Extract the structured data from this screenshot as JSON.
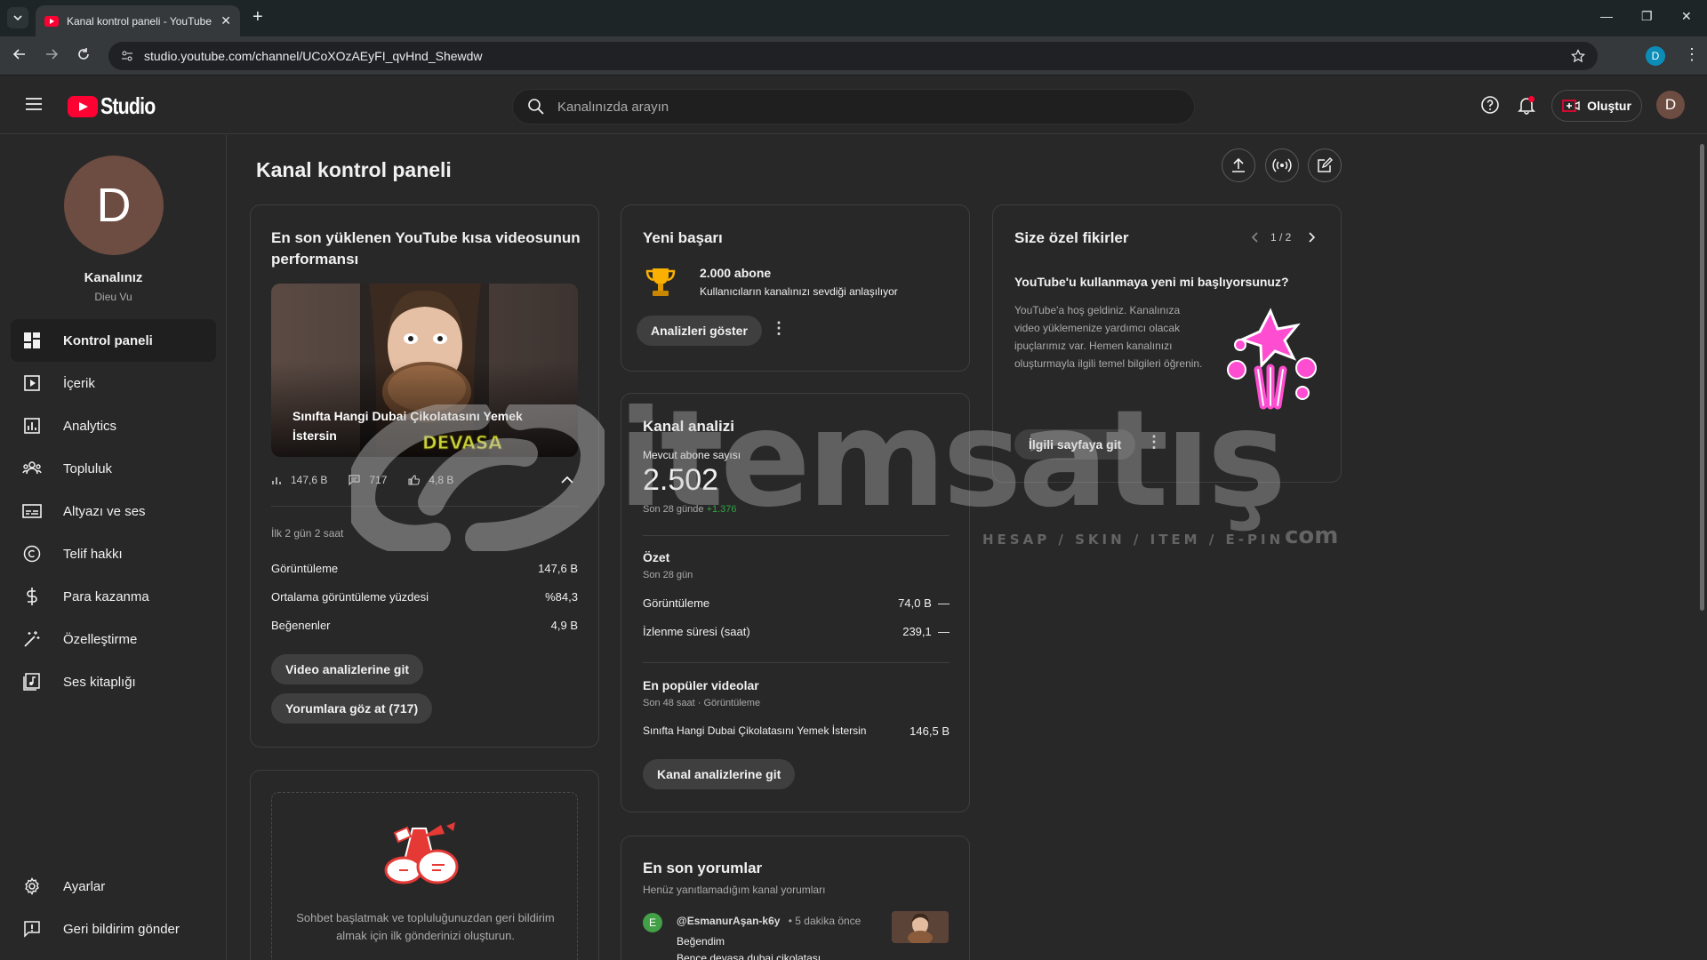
{
  "browser": {
    "tab_title": "Kanal kontrol paneli - YouTube",
    "url": "studio.youtube.com/channel/UCoXOzAEyFI_qvHnd_Shewdw",
    "profile_initial": "D"
  },
  "header": {
    "logo_text": "Studio",
    "search_placeholder": "Kanalınızda arayın",
    "create_label": "Oluştur",
    "avatar_initial": "D"
  },
  "sidebar": {
    "avatar_initial": "D",
    "channel_label": "Kanalınız",
    "channel_name": "Dieu Vu",
    "items": [
      {
        "label": "Kontrol paneli",
        "icon": "dashboard-icon"
      },
      {
        "label": "İçerik",
        "icon": "content-icon"
      },
      {
        "label": "Analytics",
        "icon": "analytics-icon"
      },
      {
        "label": "Topluluk",
        "icon": "community-icon"
      },
      {
        "label": "Altyazı ve ses",
        "icon": "subtitles-icon"
      },
      {
        "label": "Telif hakkı",
        "icon": "copyright-icon"
      },
      {
        "label": "Para kazanma",
        "icon": "dollar-icon"
      },
      {
        "label": "Özelleştirme",
        "icon": "magic-wand-icon"
      },
      {
        "label": "Ses kitaplığı",
        "icon": "audio-library-icon"
      }
    ],
    "bottom_items": [
      {
        "label": "Ayarlar",
        "icon": "gear-icon"
      },
      {
        "label": "Geri bildirim gönder",
        "icon": "feedback-icon"
      }
    ]
  },
  "main": {
    "page_title": "Kanal kontrol paneli",
    "shorts_card": {
      "title": "En son yüklenen YouTube kısa videosunun performansı",
      "video_caption": "Sınıfta Hangi Dubai Çikolatasını Yemek İstersin",
      "thumb_overlay_text": "DEVASA",
      "stat_views": "147,6 B",
      "stat_comments": "717",
      "stat_likes": "4,8 B",
      "period": "İlk 2 gün 2 saat",
      "rows": [
        {
          "label": "Görüntüleme",
          "value": "147,6 B"
        },
        {
          "label": "Ortalama görüntüleme yüzdesi",
          "value": "%84,3"
        },
        {
          "label": "Beğenenler",
          "value": "4,9 B"
        }
      ],
      "btn_analytics": "Video analizlerine git",
      "btn_comments": "Yorumlara göz at (717)"
    },
    "community_card": {
      "text": "Sohbet başlatmak ve topluluğunuzdan geri bildirim almak için ilk gönderinizi oluşturun."
    },
    "achievement_card": {
      "title": "Yeni başarı",
      "headline": "2.000 abone",
      "subtext": "Kullanıcıların kanalınızı sevdiği anlaşılıyor",
      "button": "Analizleri göster"
    },
    "analytics_card": {
      "title": "Kanal analizi",
      "current_subs_label": "Mevcut abone sayısı",
      "current_subs": "2.502",
      "last28_prefix": "Son 28 günde",
      "last28_delta": "+1.376",
      "summary_title": "Özet",
      "summary_period": "Son 28 gün",
      "summary_rows": [
        {
          "label": "Görüntüleme",
          "value": "74,0 B",
          "trend": "—"
        },
        {
          "label": "İzlenme süresi (saat)",
          "value": "239,1",
          "trend": "—"
        }
      ],
      "top_title": "En popüler videolar",
      "top_period": "Son 48 saat · Görüntüleme",
      "top_rows": [
        {
          "label": "Sınıfta Hangi Dubai Çikolatasını Yemek İstersin",
          "value": "146,5 B"
        }
      ],
      "button": "Kanal analizlerine git"
    },
    "comments_card": {
      "title": "En son yorumlar",
      "subtitle": "Henüz yanıtlamadığım kanal yorumları",
      "comment_initial": "E",
      "comment_author": "@EsmanurAşan-k6y",
      "comment_time": "• 5 dakika önce",
      "comment_text": "Beğendim",
      "comment_text_2": "Bence devasa dubai çikolatası"
    },
    "ideas_card": {
      "title": "Size özel fikirler",
      "pager": "1 / 2",
      "headline": "YouTube'u kullanmaya yeni mi başlıyorsunuz?",
      "body": "YouTube'a hoş geldiniz. Kanalınıza video yüklemenize yardımcı olacak ipuçlarımız var. Hemen kanalınızı oluşturmayla ilgili temel bilgileri öğrenin.",
      "button": "İlgili sayfaya git"
    }
  },
  "watermark": {
    "word": "itemsatış",
    "tagline": "HESAP / SKIN / ITEM / E-PIN",
    "suffix": "com"
  },
  "colors": {
    "accent_red": "#ff0033",
    "delta_green": "#2ba640",
    "ideas_pink": "#ff4dd2"
  }
}
